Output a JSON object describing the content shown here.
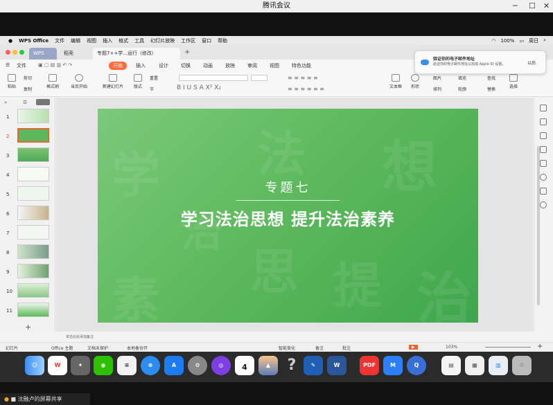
{
  "window": {
    "title": "腾讯会议"
  },
  "mac_menu": {
    "apple": "",
    "app": "WPS Office",
    "items": [
      "文件",
      "编辑",
      "视图",
      "插入",
      "格式",
      "工具",
      "幻灯片放映",
      "工作区",
      "窗口",
      "帮助"
    ],
    "right": [
      "100%",
      "周日"
    ]
  },
  "tabs": [
    {
      "label": "WPS"
    },
    {
      "label": "稻壳"
    },
    {
      "label": "专题7++学...运行（修改）"
    }
  ],
  "menu": {
    "file": "文件",
    "items": [
      "开始",
      "插入",
      "设计",
      "切换",
      "动画",
      "放映",
      "审阅",
      "视图",
      "特色功能"
    ]
  },
  "toolbar": {
    "paste": "粘贴",
    "cut": "剪切",
    "copy": "复制",
    "format": "格式刷",
    "from_current": "当页开始",
    "new_slide": "新建幻灯片",
    "layout": "版式",
    "section": "节",
    "reset": "重置",
    "textbox": "文本框",
    "shape": "形状",
    "picture": "图片",
    "arrange": "排列",
    "fill": "填充",
    "outline": "轮廓",
    "find": "查找",
    "replace": "替换",
    "select": "选择"
  },
  "notification": {
    "title": "验证你的电子邮件地址",
    "body": "验证你的电子邮件地址以完成 Apple ID 设置。",
    "action": "以后"
  },
  "slides": [
    "1",
    "2",
    "3",
    "4",
    "5",
    "6",
    "7",
    "8",
    "9",
    "10",
    "11"
  ],
  "slide": {
    "subtitle": "专题七",
    "title": "学习法治思想  提升法治素养",
    "bg_chars": [
      "学",
      "法",
      "想",
      "治",
      "素",
      "提",
      "治",
      "思"
    ]
  },
  "notes_placeholder": "单击此处添加备注",
  "status": {
    "slide": "幻灯片",
    "theme": "Office 主题",
    "protect": "文档未保护",
    "backup": "本地备份开",
    "beautify": "智能美化",
    "notes": "备注",
    "comment": "批注",
    "zoom": "103%"
  },
  "dock": [
    "Finder",
    "WPS",
    "Rocket",
    "WeChat",
    "Notes",
    "Safari",
    "App Store",
    "Settings",
    "Siri",
    "Calendar",
    "Photos",
    "Help",
    "Pen",
    "Word",
    "PDF",
    "Tencent",
    "Q",
    "Doc",
    "Preview",
    "Files",
    "Trash"
  ],
  "calendar_day": "4",
  "share": {
    "label": "沈融卢的屏幕共享"
  }
}
